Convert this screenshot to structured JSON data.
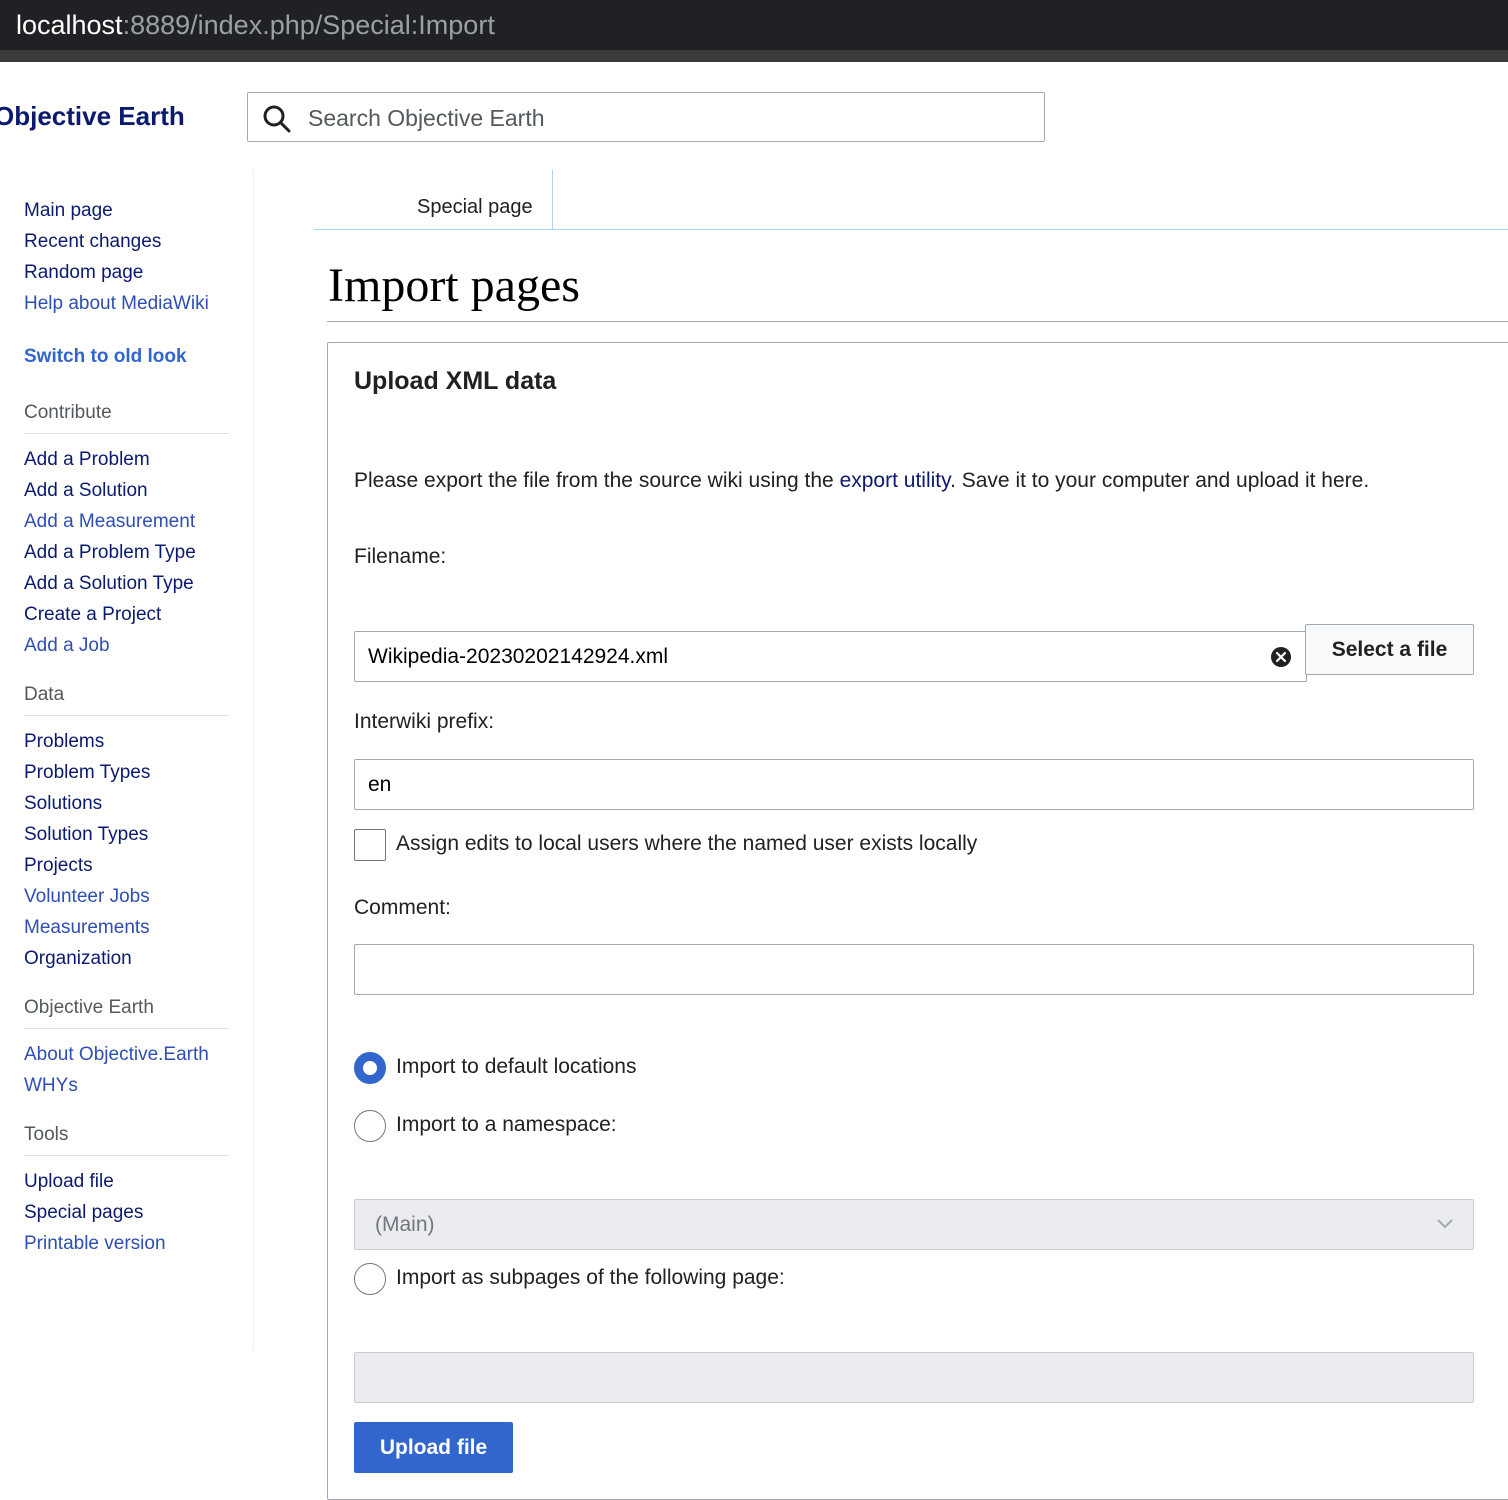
{
  "browser": {
    "url_host": "localhost",
    "url_path": ":8889/index.php/Special:Import"
  },
  "site": {
    "name": "Objective Earth"
  },
  "search": {
    "placeholder": "Search Objective Earth"
  },
  "sidebar": {
    "nav": [
      "Main page",
      "Recent changes",
      "Random page",
      "Help about MediaWiki"
    ],
    "switch_look": "Switch to old look",
    "contribute": {
      "heading": "Contribute",
      "items": [
        "Add a Problem",
        "Add a Solution",
        "Add a Measurement",
        "Add a Problem Type",
        "Add a Solution Type",
        "Create a Project",
        "Add a Job"
      ]
    },
    "data": {
      "heading": "Data",
      "items": [
        "Problems",
        "Problem Types",
        "Solutions",
        "Solution Types",
        "Projects",
        "Volunteer Jobs",
        "Measurements",
        "Organization"
      ]
    },
    "objective_earth": {
      "heading": "Objective Earth",
      "items": [
        "About Objective.Earth",
        "WHYs"
      ]
    },
    "tools": {
      "heading": "Tools",
      "items": [
        "Upload file",
        "Special pages",
        "Printable version"
      ]
    }
  },
  "tabs": {
    "special_page": "Special page"
  },
  "page": {
    "title": "Import pages"
  },
  "form": {
    "legend": "Upload XML data",
    "intro_before": "Please export the file from the source wiki using the ",
    "intro_link": "export utility",
    "intro_after": ". Save it to your computer and upload it here.",
    "filename_label": "Filename:",
    "filename_value": "Wikipedia-20230202142924.xml",
    "select_file_label": "Select a file",
    "interwiki_label": "Interwiki prefix:",
    "interwiki_value": "en",
    "assign_edits_label": "Assign edits to local users where the named user exists locally",
    "comment_label": "Comment:",
    "comment_value": "",
    "radio_default": "Import to default locations",
    "radio_namespace": "Import to a namespace:",
    "namespace_selected": "(Main)",
    "radio_subpages": "Import as subpages of the following page:",
    "subpage_value": "",
    "upload_label": "Upload file"
  }
}
